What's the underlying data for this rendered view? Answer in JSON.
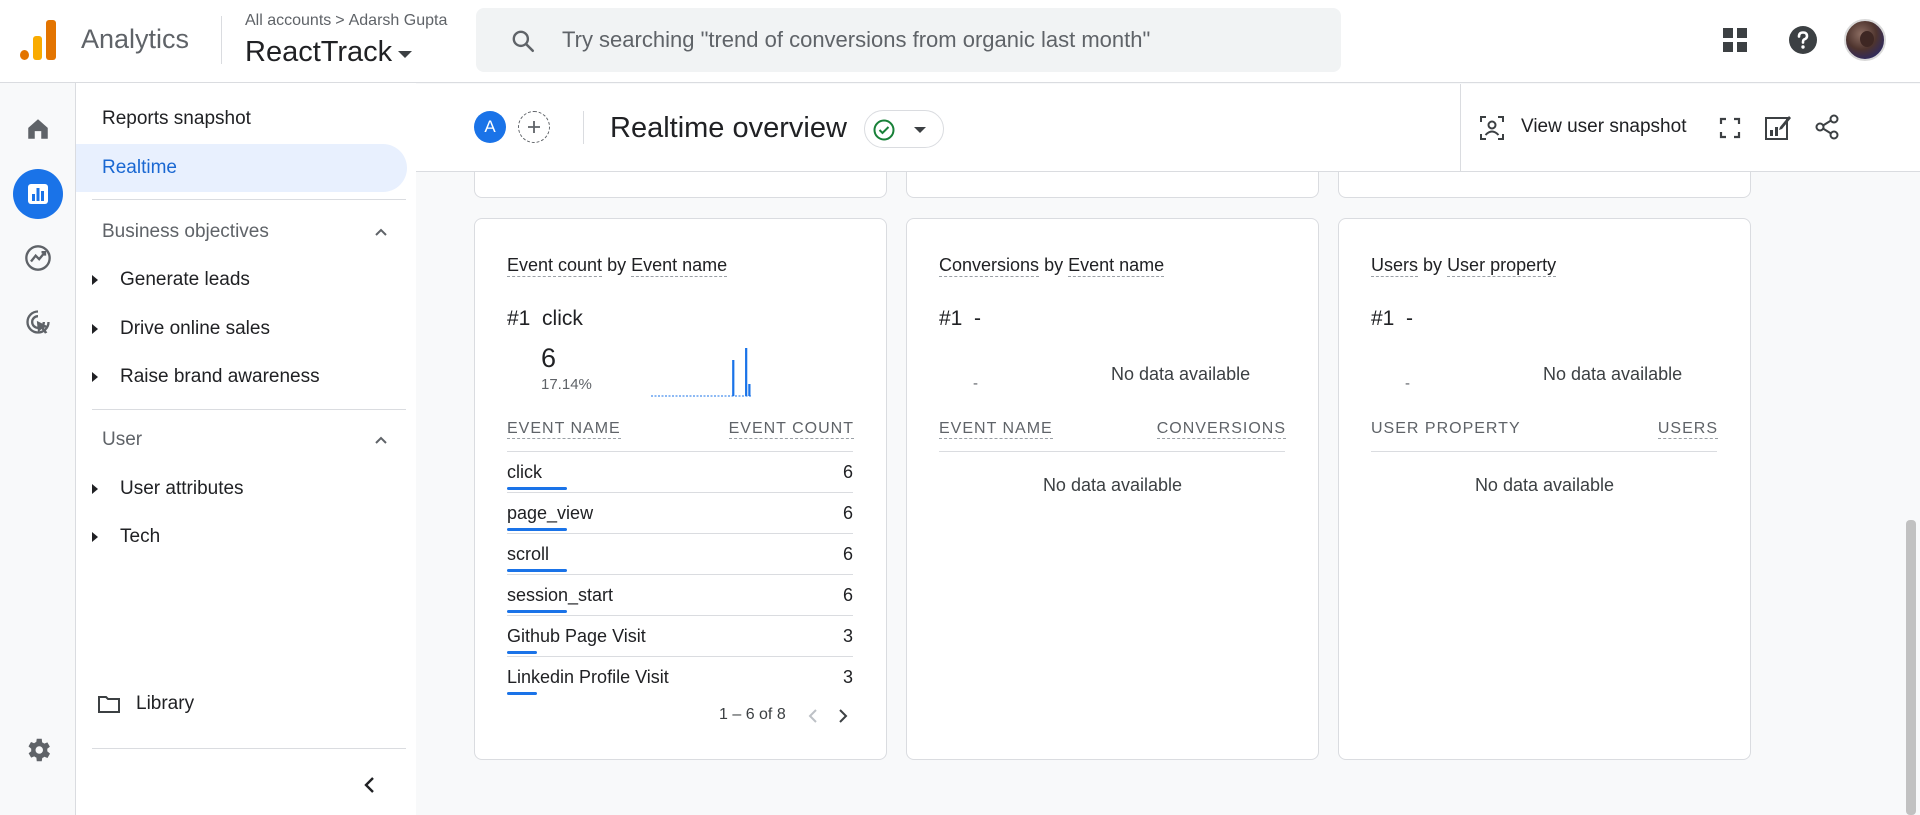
{
  "header": {
    "app_name": "Analytics",
    "breadcrumb": {
      "accounts": "All accounts",
      "separator": ">",
      "account": "Adarsh Gupta"
    },
    "property": "ReactTrack",
    "search_placeholder": "Try searching \"trend of conversions from organic last month\"",
    "icons": [
      "apps-grid-icon",
      "help-icon",
      "account-avatar"
    ]
  },
  "nav": {
    "reports_snapshot": "Reports snapshot",
    "realtime": "Realtime",
    "section_business": "Business objectives",
    "business_items": [
      "Generate leads",
      "Drive online sales",
      "Raise brand awareness"
    ],
    "section_user": "User",
    "user_items": [
      "User attributes",
      "Tech"
    ],
    "library": "Library"
  },
  "toolbar": {
    "compare_avatar": "A",
    "title": "Realtime overview",
    "view_user_snapshot": "View user snapshot"
  },
  "cards": {
    "event_count": {
      "title_metric": "Event count",
      "title_by": "by",
      "title_dim": "Event name",
      "rank": "#1",
      "top_name": "click",
      "top_value": "6",
      "top_pct": "17.14%",
      "sparkline": [
        0,
        0,
        0,
        0,
        0,
        0,
        0,
        0,
        0,
        0,
        0,
        0,
        0,
        0,
        0,
        0,
        0,
        0,
        0,
        0,
        0,
        0,
        0,
        0,
        0,
        3,
        0,
        0,
        0,
        4,
        1
      ],
      "col_name": "EVENT NAME",
      "col_value": "EVENT COUNT",
      "rows": [
        {
          "name": "click",
          "value": "6",
          "share": 1.0
        },
        {
          "name": "page_view",
          "value": "6",
          "share": 1.0
        },
        {
          "name": "scroll",
          "value": "6",
          "share": 1.0
        },
        {
          "name": "session_start",
          "value": "6",
          "share": 1.0
        },
        {
          "name": "Github Page Visit",
          "value": "3",
          "share": 0.5
        },
        {
          "name": "Linkedin Profile Visit",
          "value": "3",
          "share": 0.5
        }
      ],
      "pagination": "1 – 6 of 8"
    },
    "conversions": {
      "title_metric": "Conversions",
      "title_by": "by",
      "title_dim": "Event name",
      "rank": "#1  -",
      "dash": "-",
      "no_data_top": "No data available",
      "col_name": "EVENT NAME",
      "col_value": "CONVERSIONS",
      "no_data": "No data available"
    },
    "users": {
      "title_metric": "Users",
      "title_by": "by",
      "title_dim": "User property",
      "rank": "#1  -",
      "dash": "-",
      "no_data_top": "No data available",
      "col_name": "USER PROPERTY",
      "col_value": "USERS",
      "no_data": "No data available"
    }
  },
  "colors": {
    "accent": "#1a73e8",
    "logo_orange": "#f9ab00",
    "logo_dark": "#e37400",
    "success": "#188038"
  }
}
